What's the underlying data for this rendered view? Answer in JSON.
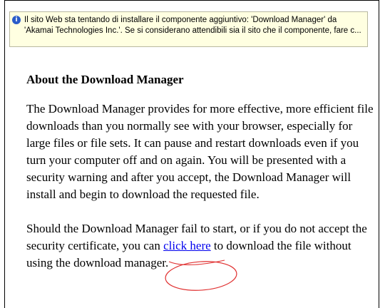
{
  "infobar": {
    "icon": "info-icon",
    "line1": "Il sito Web sta tentando di installare il componente aggiuntivo: 'Download Manager' da",
    "line2": "'Akamai Technologies Inc.'. Se si considerano attendibili sia il sito che il componente, fare c..."
  },
  "content": {
    "heading": "About the Download Manager",
    "para1": "The Download Manager provides for more effective, more efficient file downloads than you normally see with your browser, especially for large files or file sets. It can pause and restart downloads even if you turn your computer off and on again. You will be presented with a security warning and after you accept, the Download Manager will install and begin to download the requested file.",
    "para2_before": "Should the Download Manager fail to start, or if you do not accept the security certificate, you can ",
    "link_text": "click here",
    "para2_after": " to download the file without using the download manager."
  },
  "annotation_color": "#e03030"
}
